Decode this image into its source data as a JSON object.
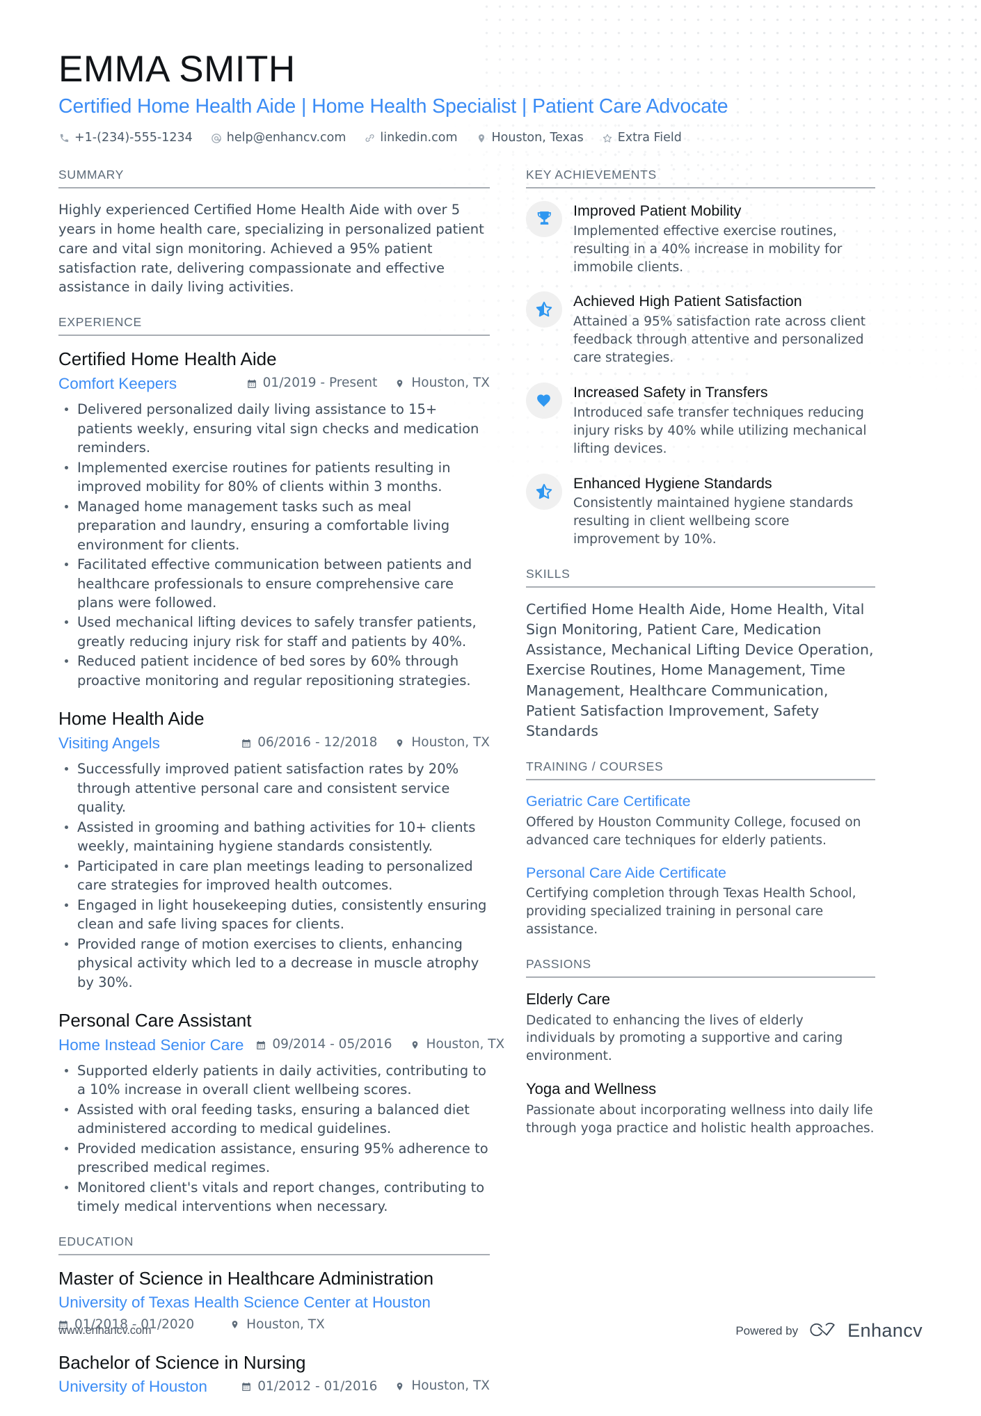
{
  "header": {
    "name": "EMMA SMITH",
    "headline": "Certified Home Health Aide | Home Health Specialist | Patient Care Advocate",
    "contacts": [
      {
        "icon": "phone-icon",
        "text": "+1-(234)-555-1234"
      },
      {
        "icon": "email-icon",
        "text": "help@enhancv.com"
      },
      {
        "icon": "link-icon",
        "text": "linkedin.com"
      },
      {
        "icon": "location-icon",
        "text": "Houston, Texas"
      },
      {
        "icon": "star-icon",
        "text": "Extra Field"
      }
    ]
  },
  "summary": {
    "title": "SUMMARY",
    "text": "Highly experienced Certified Home Health Aide with over 5 years in home health care, specializing in personalized patient care and vital sign monitoring. Achieved a 95% patient satisfaction rate, delivering compassionate and effective assistance in daily living activities."
  },
  "experience": {
    "title": "EXPERIENCE",
    "entries": [
      {
        "role": "Certified Home Health Aide",
        "company": "Comfort Keepers",
        "dates": "01/2019 - Present",
        "location": "Houston, TX",
        "bullets": [
          "Delivered personalized daily living assistance to 15+ patients weekly, ensuring vital sign checks and medication reminders.",
          "Implemented exercise routines for patients resulting in improved mobility for 80% of clients within 3 months.",
          "Managed home management tasks such as meal preparation and laundry, ensuring a comfortable living environment for clients.",
          "Facilitated effective communication between patients and healthcare professionals to ensure comprehensive care plans were followed.",
          "Used mechanical lifting devices to safely transfer patients, greatly reducing injury risk for staff and patients by 40%.",
          "Reduced patient incidence of bed sores by 60% through proactive monitoring and regular repositioning strategies."
        ]
      },
      {
        "role": "Home Health Aide",
        "company": "Visiting Angels",
        "dates": "06/2016 - 12/2018",
        "location": "Houston, TX",
        "bullets": [
          "Successfully improved patient satisfaction rates by 20% through attentive personal care and consistent service quality.",
          "Assisted in grooming and bathing activities for 10+ clients weekly, maintaining hygiene standards consistently.",
          "Participated in care plan meetings leading to personalized care strategies for improved health outcomes.",
          "Engaged in light housekeeping duties, consistently ensuring clean and safe living spaces for clients.",
          "Provided range of motion exercises to clients, enhancing physical activity which led to a decrease in muscle atrophy by 30%."
        ]
      },
      {
        "role": "Personal Care Assistant",
        "company": "Home Instead Senior Care",
        "dates": "09/2014 - 05/2016",
        "location": "Houston, TX",
        "bullets": [
          "Supported elderly patients in daily activities, contributing to a 10% increase in overall client wellbeing scores.",
          "Assisted with oral feeding tasks, ensuring a balanced diet administered according to medical guidelines.",
          "Provided medication assistance, ensuring 95% adherence to prescribed medical regimes.",
          "Monitored client's vitals and report changes, contributing to timely medical interventions when necessary."
        ]
      }
    ]
  },
  "education": {
    "title": "EDUCATION",
    "entries": [
      {
        "degree": "Master of Science in Healthcare Administration",
        "school": "University of Texas Health Science Center at Houston",
        "dates": "01/2018 - 01/2020",
        "location": "Houston, TX",
        "layout": "stacked"
      },
      {
        "degree": "Bachelor of Science in Nursing",
        "school": "University of Houston",
        "dates": "01/2012 - 01/2016",
        "location": "Houston, TX",
        "layout": "inline"
      }
    ]
  },
  "key_achievements": {
    "title": "KEY ACHIEVEMENTS",
    "items": [
      {
        "icon": "trophy-icon",
        "title": "Improved Patient Mobility",
        "desc": "Implemented effective exercise routines, resulting in a 40% increase in mobility for immobile clients."
      },
      {
        "icon": "half-star-icon",
        "title": "Achieved High Patient Satisfaction",
        "desc": "Attained a 95% satisfaction rate across client feedback through attentive and personalized care strategies."
      },
      {
        "icon": "heart-icon",
        "title": "Increased Safety in Transfers",
        "desc": "Introduced safe transfer techniques reducing injury risks by 40% while utilizing mechanical lifting devices."
      },
      {
        "icon": "half-star-icon",
        "title": "Enhanced Hygiene Standards",
        "desc": "Consistently maintained hygiene standards resulting in client wellbeing score improvement by 10%."
      }
    ]
  },
  "skills": {
    "title": "SKILLS",
    "text": "Certified Home Health Aide, Home Health, Vital Sign Monitoring, Patient Care, Medication Assistance, Mechanical Lifting Device Operation, Exercise Routines, Home Management, Time Management, Healthcare Communication, Patient Satisfaction Improvement, Safety Standards"
  },
  "training": {
    "title": "TRAINING / COURSES",
    "items": [
      {
        "name": "Geriatric Care Certificate",
        "desc": "Offered by Houston Community College, focused on advanced care techniques for elderly patients."
      },
      {
        "name": "Personal Care Aide Certificate",
        "desc": "Certifying completion through Texas Health School, providing specialized training in personal care assistance."
      }
    ]
  },
  "passions": {
    "title": "PASSIONS",
    "items": [
      {
        "name": "Elderly Care",
        "desc": "Dedicated to enhancing the lives of elderly individuals by promoting a supportive and caring environment."
      },
      {
        "name": "Yoga and Wellness",
        "desc": "Passionate about incorporating wellness into daily life through yoga practice and holistic health approaches."
      }
    ]
  },
  "footer": {
    "url": "www.enhancv.com",
    "powered_by": "Powered by",
    "brand": "Enhancv"
  },
  "colors": {
    "accent": "#3b8cf5",
    "icon_accent": "#2f97f0",
    "text": "#3f4d5b",
    "heading": "#5c6a78"
  }
}
